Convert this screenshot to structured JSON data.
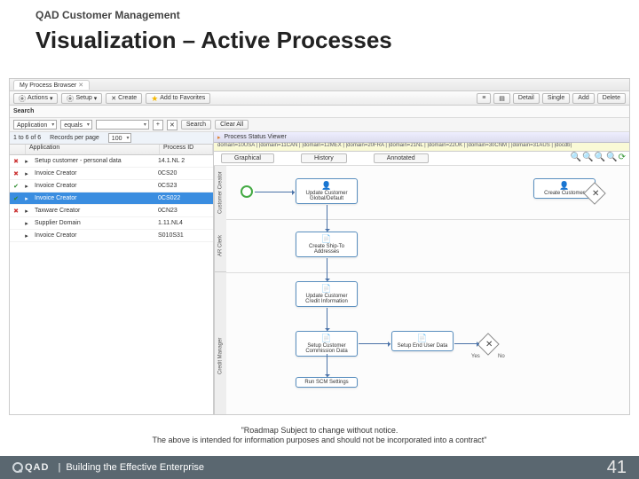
{
  "slide": {
    "module": "QAD Customer Management",
    "title": "Visualization – Active Processes",
    "disclaimer1": "\"Roadmap Subject to change without notice.",
    "disclaimer2": "The above is intended for information purposes and should not be incorporated into a contract\"",
    "footer_sep": "|",
    "footer_tag": "Building the Effective Enterprise",
    "page": "41",
    "brand": "QAD"
  },
  "app": {
    "tab": "My Process Browser",
    "toolbar": {
      "actions": "Actions",
      "setup": "Setup",
      "create": "Create",
      "fav": "Add to Favorites",
      "grid": "≡",
      "detail": "Detail",
      "single": "Single",
      "add": "Add",
      "delete": "Delete"
    },
    "search_label": "Search",
    "filter": {
      "field1": "Application",
      "op": "equals",
      "val": "",
      "records_label": "Records per page",
      "records_val": "100",
      "search_btn": "Search",
      "clear_btn": "Clear All"
    },
    "left": {
      "count_label": "1 to 6 of 6",
      "col1": "Application",
      "col2": "Process ID"
    },
    "rows": [
      {
        "ic": "✖",
        "cls": "red",
        "lbl": "Setup customer - personal data",
        "code": "14.1.NL 2"
      },
      {
        "ic": "✖",
        "cls": "red",
        "lbl": "Invoice Creator",
        "code": "0CS20"
      },
      {
        "ic": "✔",
        "cls": "grn",
        "lbl": "Invoice Creator",
        "code": "0CS23"
      },
      {
        "ic": "✔",
        "cls": "grn",
        "lbl": "Invoice Creator",
        "code": "0CS022"
      },
      {
        "ic": "✖",
        "cls": "red",
        "lbl": "Taxware Creator",
        "code": "0CN23"
      },
      {
        "ic": " ",
        "cls": "",
        "lbl": "Supplier Domain",
        "code": "1.11.NL4"
      },
      {
        "ic": " ",
        "cls": "",
        "lbl": "Invoice Creator",
        "code": "S010S31"
      }
    ],
    "viewer_title": "Process Status Viewer",
    "domains": "domain=10USA | |domain=11CAN | |domain=12MEX | |domain=20FRA | |domain=21NL | |domain=22UK | |domain=30CNM | |domain=31AUS | |docdb|",
    "subtabs": {
      "t1": "Graphical",
      "t2": "History",
      "t3": "Annotated"
    },
    "lanes": {
      "l1": "Customer Creator",
      "l2": "AR Clerk",
      "l3": "Credit Manager"
    },
    "nodes": {
      "n1": "Update Customer\nGlobal/Default",
      "n2": "Create Customer",
      "n3": "Create Ship-To\nAddresses",
      "n4": "Update Customer\nCredit Information",
      "n5": "Setup Customer\nCommission Data",
      "n6": "Setup End User Data",
      "n7": "Run SCM Settings"
    },
    "gw": {
      "yes": "Yes",
      "no": "No"
    }
  }
}
